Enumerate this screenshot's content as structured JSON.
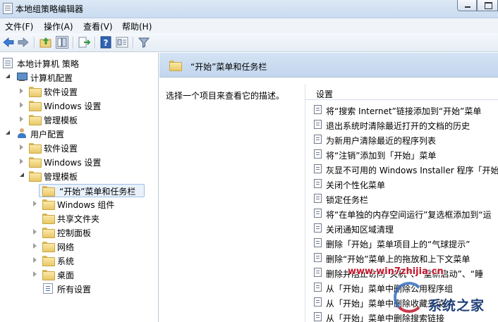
{
  "window": {
    "title": "本地组策略编辑器"
  },
  "menu": {
    "items": [
      "文件(F)",
      "操作(A)",
      "查看(V)",
      "帮助(H)"
    ]
  },
  "toolbar": {
    "icons": [
      "back-arrow-icon",
      "forward-arrow-icon",
      "up-folder-icon",
      "show-hide-tree-icon",
      "export-list-icon",
      "help-icon",
      "properties-icon",
      "filter-icon"
    ]
  },
  "tree": {
    "root": "本地计算机 策略",
    "computer_config": "计算机配置",
    "computer_software": "软件设置",
    "computer_windows": "Windows 设置",
    "computer_admin": "管理模板",
    "user_config": "用户配置",
    "user_software": "软件设置",
    "user_windows": "Windows 设置",
    "user_admin": "管理模板",
    "start_menu": "“开始”菜单和任务栏",
    "windows_components": "Windows 组件",
    "shared_folders": "共享文件夹",
    "control_panel": "控制面板",
    "network": "网络",
    "system": "系统",
    "desktop": "桌面",
    "all_settings": "所有设置"
  },
  "right": {
    "header_title": "“开始”菜单和任务栏",
    "description": "选择一个项目来查看它的描述。",
    "column_header": "设置",
    "settings": [
      "将“搜索 Internet”链接添加到“开始”菜单",
      "退出系统时清除最近打开的文档的历史",
      "为新用户清除最近的程序列表",
      "将“注销”添加到「开始」菜单",
      "灰显不可用的 Windows Installer 程序「开始」",
      "关闭个性化菜单",
      "锁定任务栏",
      "将“在单独的内存空间运行”复选框添加到“运",
      "关闭通知区域清理",
      "删除「开始」菜单项目上的“气球提示”",
      "删除“开始”菜单上的拖放和上下文菜单",
      "删除并阻止访问“关机”、“重新启动”、“睡",
      "从「开始」菜单中删除公用程序组",
      "从「开始」菜单中删除收藏夹菜单",
      "从「开始」菜单中删除搜索链接"
    ]
  },
  "watermark": {
    "url": "www.win7zhijia.cn",
    "brand": "系统之家"
  }
}
